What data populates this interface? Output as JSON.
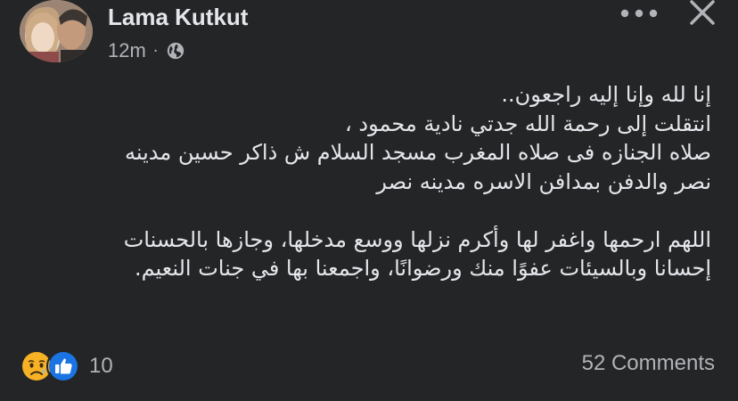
{
  "post": {
    "author": "Lama Kutkut",
    "time": "12m",
    "separator": "·",
    "privacy_icon": "globe-icon",
    "lines": [
      "إنا لله وإنا إليه راجعون..",
      "انتقلت إلى رحمة الله جدتي نادية محمود ،",
      "صلاه الجنازه فى صلاه المغرب مسجد السلام ش ذاكر حسين مدينه",
      "نصر والدفن بمدافن الاسره مدينه نصر",
      "",
      "اللهم ارحمها واغفر لها وأكرم نزلها ووسع مدخلها، وجازها بالحسنات",
      "إحسانا وبالسيئات عفوًا منك ورضوانًا، واجمعنا بها في جنات النعيم."
    ]
  },
  "header_actions": {
    "more_icon": "more-horizontal-icon",
    "close_icon": "close-icon"
  },
  "footer": {
    "reaction_icons": [
      "sad-reaction-icon",
      "like-reaction-icon"
    ],
    "reaction_count": "10",
    "comments_label": "52 Comments"
  },
  "colors": {
    "background": "#242526",
    "text_primary": "#e4e6eb",
    "text_secondary": "#b0b3b8",
    "like_blue": "#1b74e4",
    "sad_yellow": "#f7b125"
  }
}
